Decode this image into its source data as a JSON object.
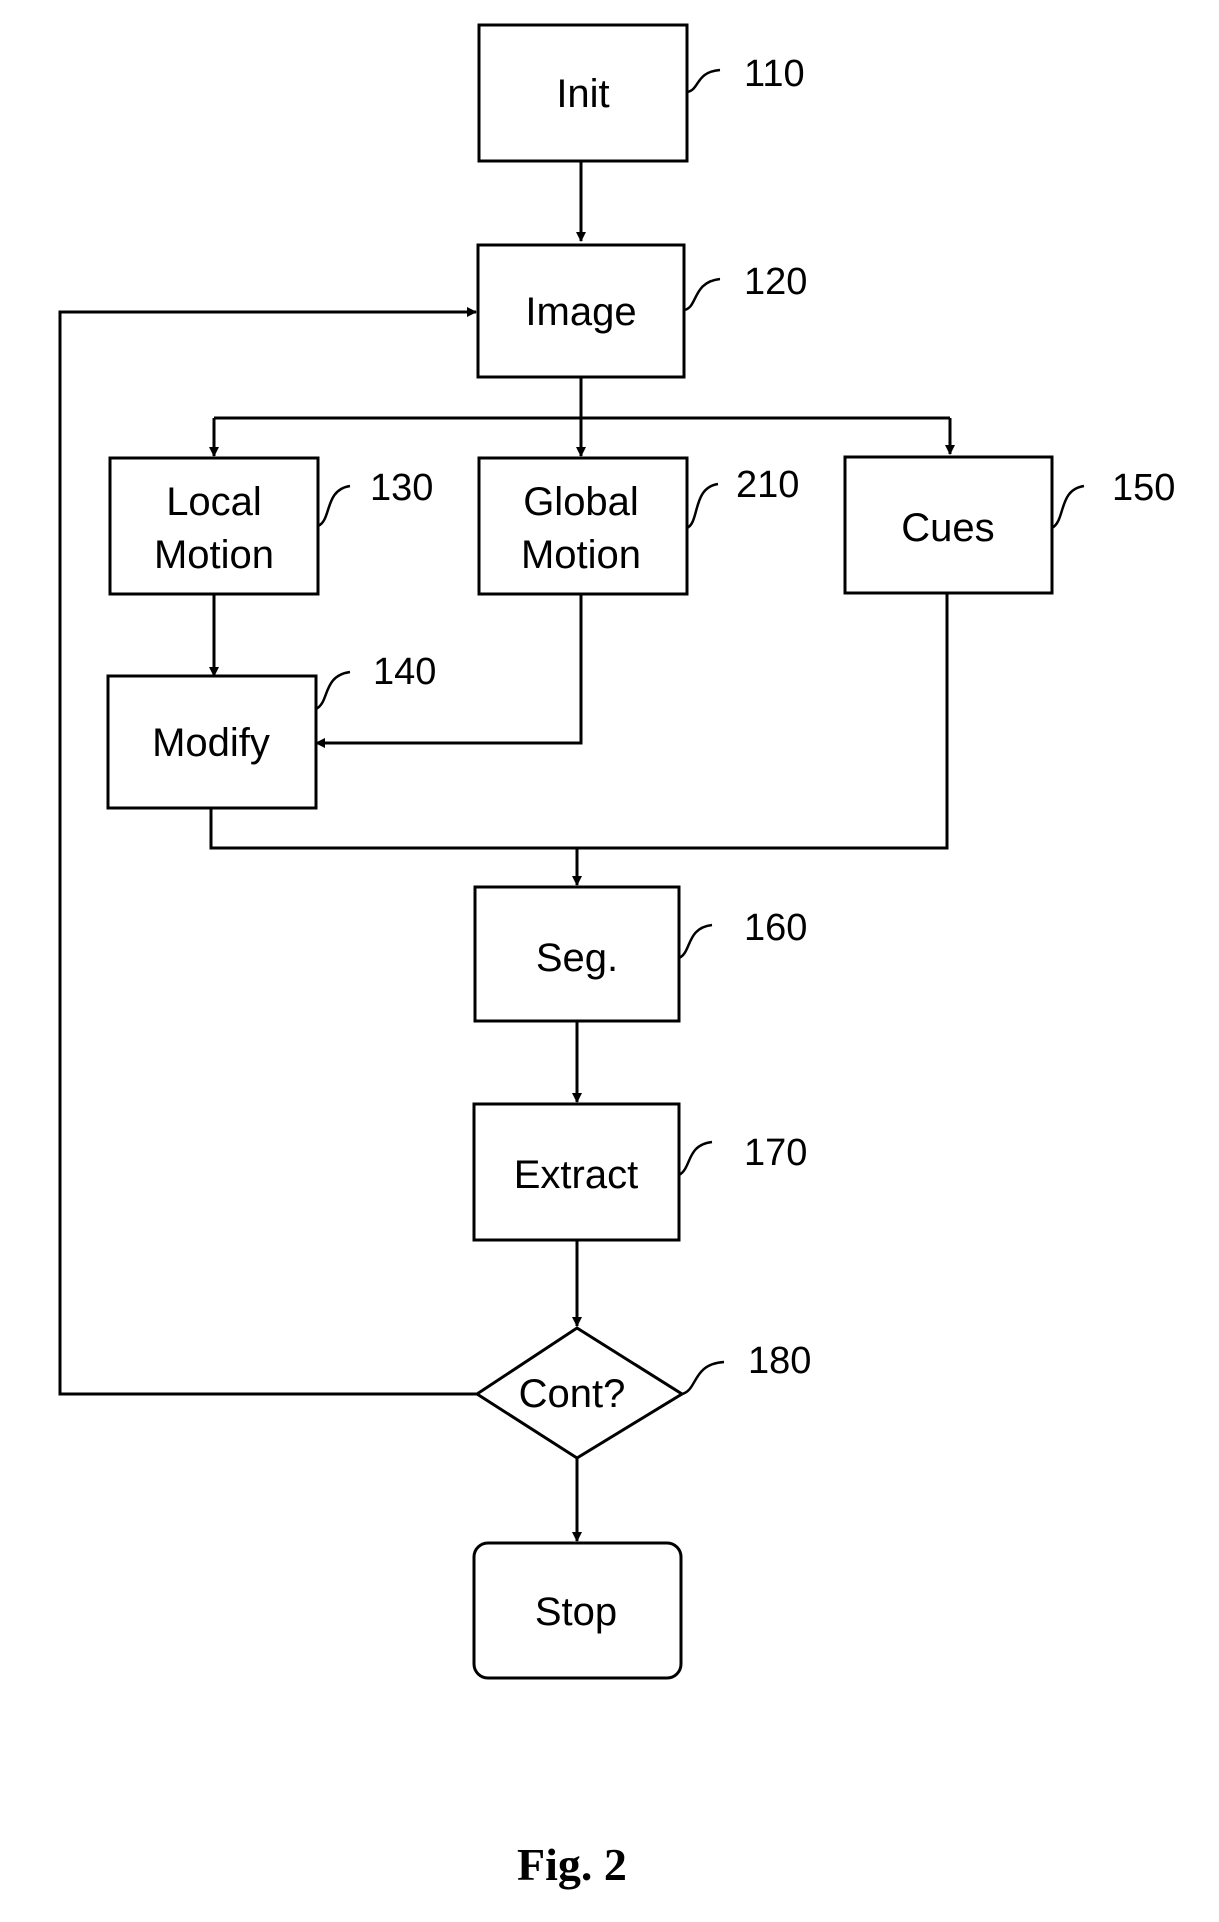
{
  "figure": {
    "caption": "Fig. 2",
    "nodes": {
      "init": {
        "label": "Init",
        "ref": "110"
      },
      "image": {
        "label": "Image",
        "ref": "120"
      },
      "local_motion": {
        "label_line1": "Local",
        "label_line2": "Motion",
        "ref": "130"
      },
      "global_motion": {
        "label_line1": "Global",
        "label_line2": "Motion",
        "ref": "210"
      },
      "cues": {
        "label": "Cues",
        "ref": "150"
      },
      "modify": {
        "label": "Modify",
        "ref": "140"
      },
      "seg": {
        "label": "Seg.",
        "ref": "160"
      },
      "extract": {
        "label": "Extract",
        "ref": "170"
      },
      "cont": {
        "label": "Cont?",
        "ref": "180"
      },
      "stop": {
        "label": "Stop"
      }
    },
    "edges": [
      [
        "Init",
        "Image"
      ],
      [
        "Image",
        "Local Motion"
      ],
      [
        "Image",
        "Global Motion"
      ],
      [
        "Image",
        "Cues"
      ],
      [
        "Local Motion",
        "Modify"
      ],
      [
        "Global Motion",
        "Modify"
      ],
      [
        "Modify",
        "Seg."
      ],
      [
        "Cues",
        "Seg."
      ],
      [
        "Seg.",
        "Extract"
      ],
      [
        "Extract",
        "Cont?"
      ],
      [
        "Cont?",
        "Image"
      ],
      [
        "Cont?",
        "Stop"
      ]
    ]
  }
}
